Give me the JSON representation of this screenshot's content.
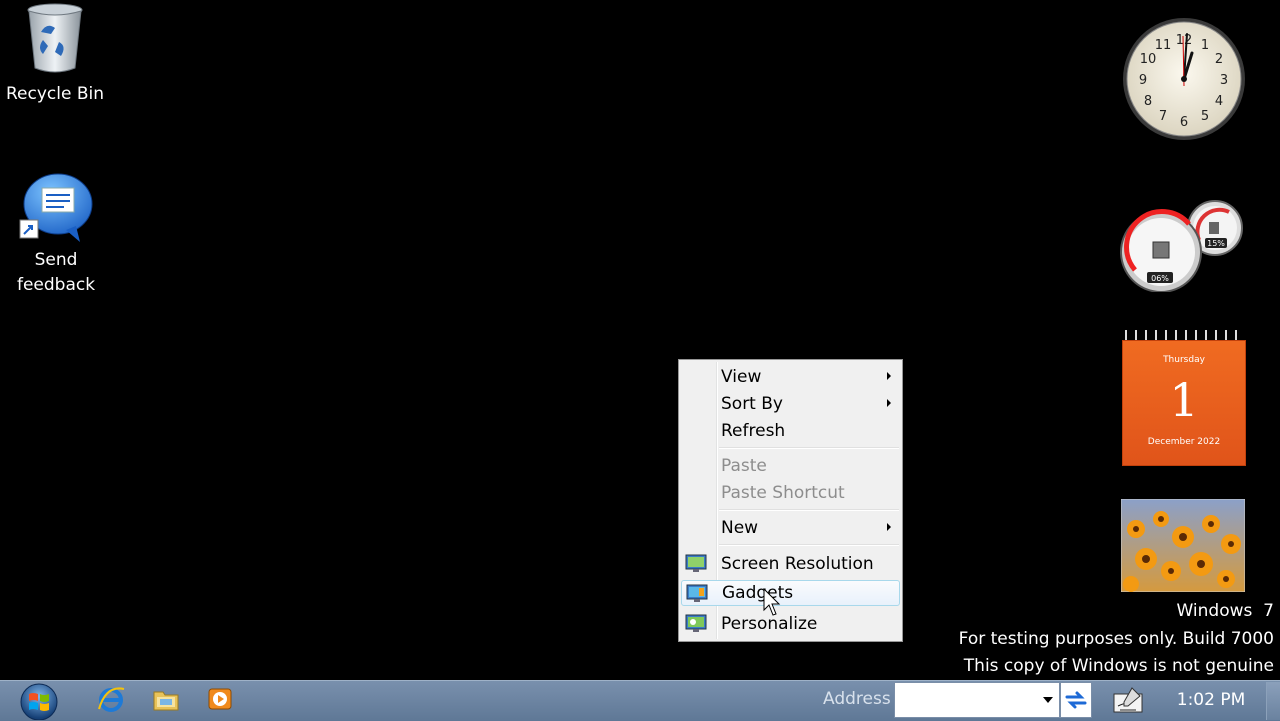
{
  "desktop": {
    "icons": [
      {
        "label": "Recycle Bin",
        "icon": "recycle-bin-icon"
      },
      {
        "label": "Send feedback",
        "icon": "feedback-icon"
      }
    ]
  },
  "gadgets": {
    "clock": {
      "hour_label_12": "12",
      "hour_label_1": "1",
      "hour_label_2": "2",
      "hour_label_3": "3",
      "hour_label_4": "4",
      "hour_label_5": "5",
      "hour_label_6": "6",
      "hour_label_7": "7",
      "hour_label_8": "8",
      "hour_label_9": "9",
      "hour_label_10": "10",
      "hour_label_11": "11"
    },
    "cpu_meter": {
      "cpu": "06%",
      "memory": "15%"
    },
    "calendar": {
      "weekday": "Thursday",
      "day": "1",
      "month_year": "December 2022"
    },
    "slideshow": {
      "icon": "flowers-photo"
    }
  },
  "context_menu": {
    "items": [
      {
        "label": "View",
        "submenu": true,
        "disabled": false
      },
      {
        "label": "Sort By",
        "submenu": true,
        "disabled": false
      },
      {
        "label": "Refresh",
        "submenu": false,
        "disabled": false
      },
      {
        "label": "Paste",
        "submenu": false,
        "disabled": true
      },
      {
        "label": "Paste Shortcut",
        "submenu": false,
        "disabled": true
      },
      {
        "label": "New",
        "submenu": true,
        "disabled": false
      },
      {
        "label": "Screen Resolution",
        "submenu": false,
        "disabled": false,
        "icon": "screen-resolution-icon"
      },
      {
        "label": "Gadgets",
        "submenu": false,
        "disabled": false,
        "icon": "gadgets-icon",
        "hovered": true
      },
      {
        "label": "Personalize",
        "submenu": false,
        "disabled": false,
        "icon": "personalize-icon"
      }
    ]
  },
  "watermark": {
    "line1": "Windows  7",
    "line2": "For testing purposes only. Build 7000",
    "line3": "This copy of Windows is not genuine"
  },
  "taskbar": {
    "address_label": "Address",
    "address_value": "",
    "time": "1:02 PM",
    "pinned": [
      "internet-explorer-icon",
      "windows-explorer-icon",
      "media-player-icon"
    ]
  },
  "colors": {
    "taskbar": "#6d85a2",
    "calendar": "#e8591c",
    "menu_bg": "#f0f0f0",
    "desktop": "#000000"
  }
}
